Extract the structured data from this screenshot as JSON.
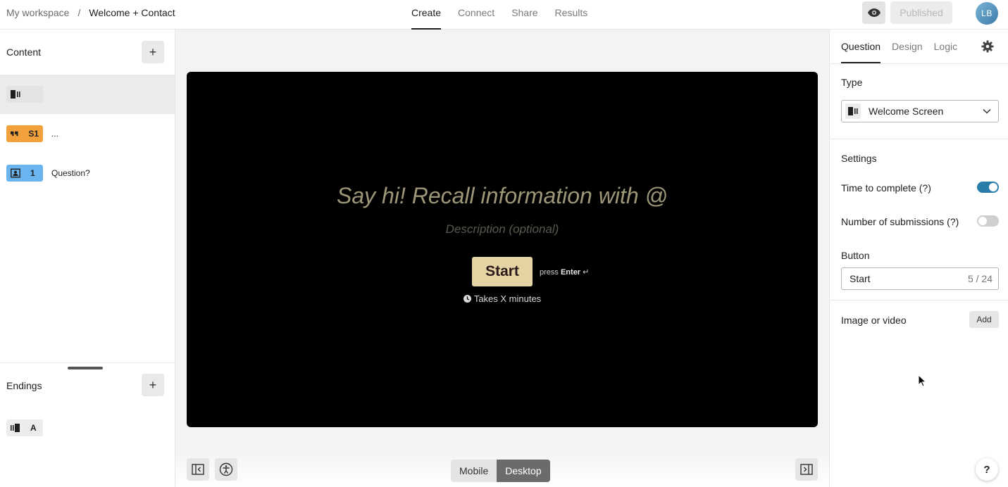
{
  "breadcrumb": {
    "workspace": "My workspace",
    "separator": "/",
    "form": "Welcome + Contact"
  },
  "nav": {
    "tabs": [
      "Create",
      "Connect",
      "Share",
      "Results"
    ],
    "active": "Create"
  },
  "header": {
    "published_label": "Published",
    "avatar_initials": "LB"
  },
  "sidebar": {
    "content_title": "Content",
    "add_label": "+",
    "blocks": [
      {
        "type": "welcome",
        "badge": "",
        "label": ""
      },
      {
        "type": "statement",
        "badge": "S1",
        "label": "..."
      },
      {
        "type": "contact",
        "badge": "1",
        "label": "Question?"
      }
    ],
    "endings_title": "Endings",
    "endings": [
      {
        "type": "ending",
        "badge": "A"
      }
    ]
  },
  "canvas": {
    "title": "Say hi! Recall information with @",
    "description": "Description (optional)",
    "start_button": "Start",
    "press_prefix": "press",
    "press_key": "Enter",
    "press_symbol": "↵",
    "takes": "Takes X minutes"
  },
  "bottom": {
    "device_options": [
      "Mobile",
      "Desktop"
    ],
    "active_device": "Desktop"
  },
  "panel": {
    "tabs": [
      "Question",
      "Design",
      "Logic"
    ],
    "active_tab": "Question",
    "type_label": "Type",
    "type_value": "Welcome Screen",
    "settings_label": "Settings",
    "time_to_complete": {
      "label": "Time to complete (?)",
      "on": true
    },
    "number_of_submissions": {
      "label": "Number of submissions (?)",
      "on": false
    },
    "button_label": "Button",
    "button_value": "Start",
    "button_count": "5 / 24",
    "media_label": "Image or video",
    "media_add": "Add"
  },
  "help_label": "?",
  "colors": {
    "accent": "#2a7da8",
    "statement_badge": "#f2a13c",
    "contact_badge": "#6ab4ef",
    "start_button": "#e6d3a3"
  }
}
